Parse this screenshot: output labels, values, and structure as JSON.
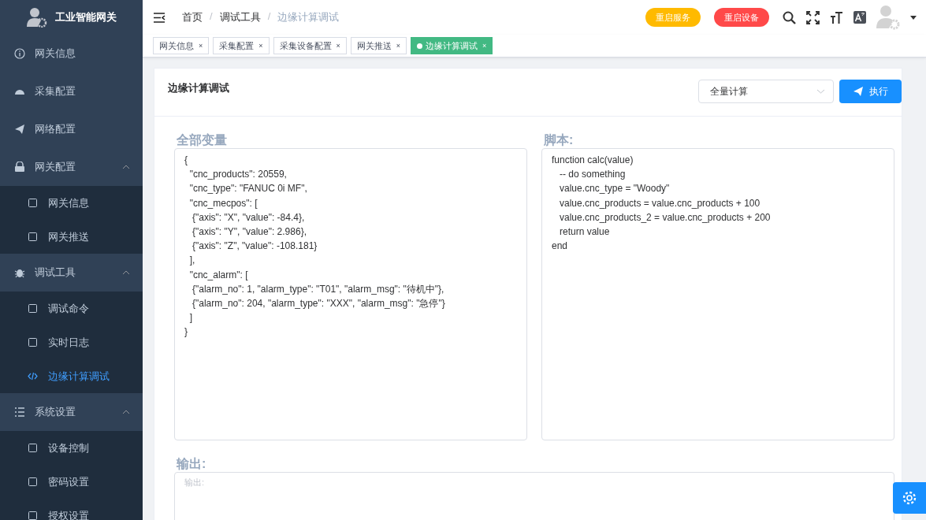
{
  "sidebar": {
    "title": "工业智能网关",
    "items": [
      {
        "label": "网关信息",
        "selected": false
      },
      {
        "label": "采集配置",
        "selected": false
      },
      {
        "label": "网络配置",
        "selected": false
      },
      {
        "label": "网关配置",
        "expanded": true,
        "children": [
          {
            "label": "网关信息",
            "selected": false
          },
          {
            "label": "网关推送",
            "selected": false
          }
        ]
      },
      {
        "label": "调试工具",
        "expanded": true,
        "children": [
          {
            "label": "调试命令",
            "selected": false
          },
          {
            "label": "实时日志",
            "selected": false
          },
          {
            "label": "边缘计算调试",
            "selected": true
          }
        ]
      },
      {
        "label": "系统设置",
        "expanded": true,
        "children": [
          {
            "label": "设备控制",
            "selected": false
          },
          {
            "label": "密码设置",
            "selected": false
          },
          {
            "label": "授权设置",
            "selected": false
          }
        ]
      }
    ]
  },
  "breadcrumb": [
    {
      "label": "首页",
      "current": false
    },
    {
      "separator": "/",
      "label": "调试工具",
      "current": false
    },
    {
      "separator": "/",
      "label": "边缘计算调试",
      "current": true
    }
  ],
  "header_buttons": [
    {
      "label": "重启服务",
      "color": "#ffba00"
    },
    {
      "label": "重启设备",
      "color": "#ff4949"
    }
  ],
  "tabs": [
    {
      "label": "网关信息",
      "close": "×",
      "selected": false
    },
    {
      "label": "采集配置",
      "close": "×",
      "selected": false
    },
    {
      "label": "采集设备配置",
      "close": "×",
      "selected": false
    },
    {
      "label": "网关推送",
      "close": "×",
      "selected": false
    },
    {
      "label": "边缘计算调试",
      "close": "×",
      "selected": true
    }
  ],
  "card": {
    "title": "边缘计算调试",
    "mode_select": {
      "value": "全量计算"
    },
    "run_button": "执行",
    "variables": {
      "label": "全部变量",
      "value": "{\n  \"cnc_products\": 20559,\n  \"cnc_type\": \"FANUC 0i MF\",\n  \"cnc_mecpos\": [\n   {\"axis\": \"X\", \"value\": -84.4},\n   {\"axis\": \"Y\", \"value\": 2.986},\n   {\"axis\": \"Z\", \"value\": -108.181}\n  ],\n  \"cnc_alarm\": [\n   {\"alarm_no\": 1, \"alarm_type\": \"T01\", \"alarm_msg\": \"待机中\"},\n   {\"alarm_no\": 204, \"alarm_type\": \"XXX\", \"alarm_msg\": \"急停\"}\n  ]\n}"
    },
    "script": {
      "label": "脚本:",
      "value": "function calc(value)\n   -- do something\n   value.cnc_type = \"Woody\"\n   value.cnc_products = value.cnc_products + 100\n   value.cnc_products_2 = value.cnc_products + 200\n   return value\nend"
    },
    "output": {
      "label": "输出:",
      "placeholder": "输出:"
    }
  }
}
